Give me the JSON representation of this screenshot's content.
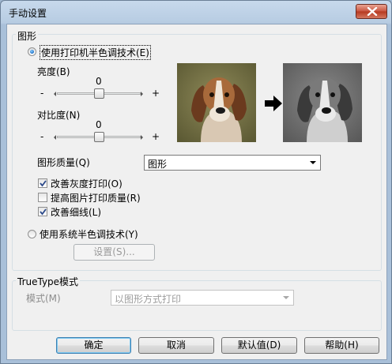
{
  "window": {
    "title": "手动设置"
  },
  "graphics_group": {
    "label": "图形",
    "printer_halftone": {
      "label": "使用打印机半色调技术(E)",
      "checked": true
    },
    "brightness": {
      "label": "亮度(B)",
      "value": "0",
      "minus": "-",
      "plus": "+",
      "level": 0.5
    },
    "contrast": {
      "label": "对比度(N)",
      "value": "0",
      "minus": "-",
      "plus": "+",
      "level": 0.5
    },
    "quality": {
      "label": "图形质量(Q)",
      "selected": "图形"
    },
    "improve_gray": {
      "label": "改善灰度打印(O)",
      "checked": true
    },
    "improve_pattern": {
      "label": "提高图片打印质量(R)",
      "checked": false
    },
    "improve_lines": {
      "label": "改善细线(L)",
      "checked": true
    },
    "system_halftone": {
      "label": "使用系统半色调技术(Y)",
      "checked": false
    },
    "settings_button": "设置(S)..."
  },
  "truetype_group": {
    "label": "TrueType模式",
    "mode_label": "模式(M)",
    "mode_selected": "以图形方式打印"
  },
  "buttons": {
    "ok": "确定",
    "cancel": "取消",
    "default": "默认值(D)",
    "help": "帮助(H)"
  },
  "colors": {
    "accent": "#3c7fb1",
    "title_gradient": "#b7cce2",
    "close_red": "#c8533e"
  }
}
